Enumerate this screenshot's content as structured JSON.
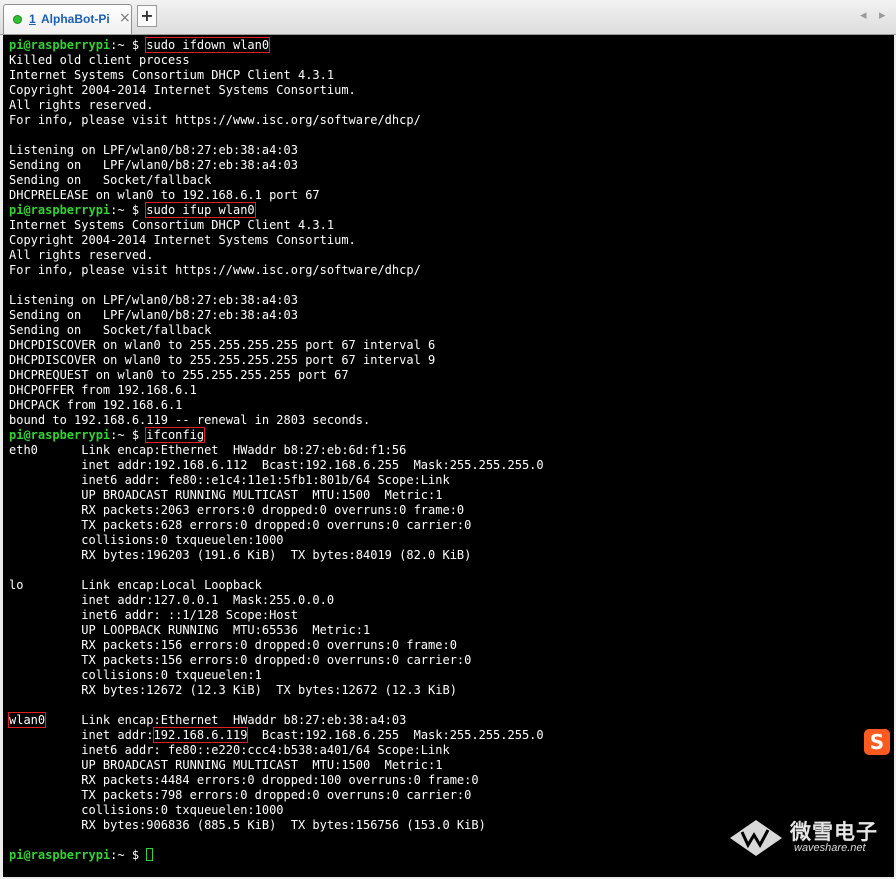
{
  "tab": {
    "index": "1",
    "title": "AlphaBot-Pi",
    "close": "×",
    "new_tab": "+"
  },
  "scroll": {
    "left": "◂",
    "right": "▸"
  },
  "prompt": "pi@raspberrypi",
  "prompt_suffix": ":~ $ ",
  "commands": [
    "sudo ifdown wlan0",
    "sudo ifup wlan0",
    "ifconfig"
  ],
  "output": {
    "ifdown": [
      "Killed old client process",
      "Internet Systems Consortium DHCP Client 4.3.1",
      "Copyright 2004-2014 Internet Systems Consortium.",
      "All rights reserved.",
      "For info, please visit https://www.isc.org/software/dhcp/",
      "",
      "Listening on LPF/wlan0/b8:27:eb:38:a4:03",
      "Sending on   LPF/wlan0/b8:27:eb:38:a4:03",
      "Sending on   Socket/fallback",
      "DHCPRELEASE on wlan0 to 192.168.6.1 port 67"
    ],
    "ifup": [
      "Internet Systems Consortium DHCP Client 4.3.1",
      "Copyright 2004-2014 Internet Systems Consortium.",
      "All rights reserved.",
      "For info, please visit https://www.isc.org/software/dhcp/",
      "",
      "Listening on LPF/wlan0/b8:27:eb:38:a4:03",
      "Sending on   LPF/wlan0/b8:27:eb:38:a4:03",
      "Sending on   Socket/fallback",
      "DHCPDISCOVER on wlan0 to 255.255.255.255 port 67 interval 6",
      "DHCPDISCOVER on wlan0 to 255.255.255.255 port 67 interval 9",
      "DHCPREQUEST on wlan0 to 255.255.255.255 port 67",
      "DHCPOFFER from 192.168.6.1",
      "DHCPACK from 192.168.6.1",
      "bound to 192.168.6.119 -- renewal in 2803 seconds."
    ],
    "eth0": [
      "eth0      Link encap:Ethernet  HWaddr b8:27:eb:6d:f1:56",
      "          inet addr:192.168.6.112  Bcast:192.168.6.255  Mask:255.255.255.0",
      "          inet6 addr: fe80::e1c4:11e1:5fb1:801b/64 Scope:Link",
      "          UP BROADCAST RUNNING MULTICAST  MTU:1500  Metric:1",
      "          RX packets:2063 errors:0 dropped:0 overruns:0 frame:0",
      "          TX packets:628 errors:0 dropped:0 overruns:0 carrier:0",
      "          collisions:0 txqueuelen:1000",
      "          RX bytes:196203 (191.6 KiB)  TX bytes:84019 (82.0 KiB)",
      ""
    ],
    "lo": [
      "lo        Link encap:Local Loopback",
      "          inet addr:127.0.0.1  Mask:255.0.0.0",
      "          inet6 addr: ::1/128 Scope:Host",
      "          UP LOOPBACK RUNNING  MTU:65536  Metric:1",
      "          RX packets:156 errors:0 dropped:0 overruns:0 frame:0",
      "          TX packets:156 errors:0 dropped:0 overruns:0 carrier:0",
      "          collisions:0 txqueuelen:1",
      "          RX bytes:12672 (12.3 KiB)  TX bytes:12672 (12.3 KiB)",
      ""
    ],
    "wlan0": {
      "name": "wlan0",
      "header_rest": "     Link encap:Ethernet  HWaddr b8:27:eb:38:a4:03",
      "inet_prefix": "          inet addr:",
      "inet_ip": "192.168.6.119",
      "inet_rest": "  Bcast:192.168.6.255  Mask:255.255.255.0",
      "lines": [
        "          inet6 addr: fe80::e220:ccc4:b538:a401/64 Scope:Link",
        "          UP BROADCAST RUNNING MULTICAST  MTU:1500  Metric:1",
        "          RX packets:4484 errors:0 dropped:100 overruns:0 frame:0",
        "          TX packets:798 errors:0 dropped:0 overruns:0 carrier:0",
        "          collisions:0 txqueuelen:1000",
        "          RX bytes:906836 (885.5 KiB)  TX bytes:156756 (153.0 KiB)",
        ""
      ]
    }
  },
  "watermark": {
    "cn": "微雪电子",
    "en": "waveshare.net"
  },
  "ime_icon": "S",
  "colors": {
    "prompt": "#30d430",
    "highlight": "#e02020",
    "background": "#000000",
    "text": "#ffffff"
  }
}
